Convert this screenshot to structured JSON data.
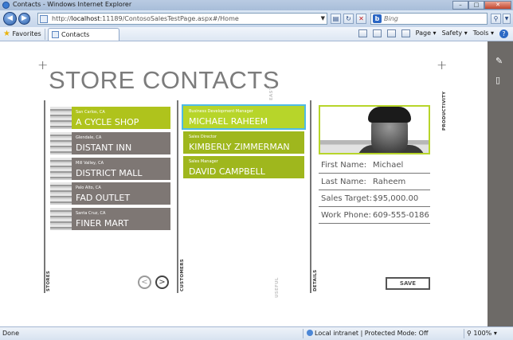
{
  "window": {
    "title": "Contacts - Windows Internet Explorer"
  },
  "address_bar": {
    "url_prefix": "http://",
    "url_host": "localhost",
    "url_rest": ":11189/ContosoSalesTestPage.aspx#/Home"
  },
  "search": {
    "placeholder": "Bing"
  },
  "favorites_bar": {
    "favorites_label": "Favorites",
    "tab_label": "Contacts",
    "menus": [
      "Page ▾",
      "Safety ▾",
      "Tools ▾"
    ]
  },
  "page": {
    "title": "STORE CONTACTS"
  },
  "section_labels": {
    "stores": "STORES",
    "customers": "CUSTOMERS",
    "details": "DETAILS",
    "easy": "EASY",
    "useful": "USEFUL",
    "productivity": "PRODUCTIVITY"
  },
  "stores": [
    {
      "city": "San Carlos, CA",
      "name": "A CYCLE SHOP",
      "selected": true
    },
    {
      "city": "Glendale, CA",
      "name": "DISTANT INN",
      "selected": false
    },
    {
      "city": "Mill Valley, CA",
      "name": "DISTRICT MALL",
      "selected": false
    },
    {
      "city": "Palo Alto, CA",
      "name": "FAD OUTLET",
      "selected": false
    },
    {
      "city": "Santa Cruz, CA",
      "name": "FINER MART",
      "selected": false
    }
  ],
  "pager": {
    "prev": "<",
    "next": ">"
  },
  "customers": [
    {
      "role": "Business Development Manager",
      "name": "MICHAEL RAHEEM",
      "selected": true
    },
    {
      "role": "Sales Director",
      "name": "KIMBERLY ZIMMERMAN",
      "selected": false
    },
    {
      "role": "Sales Manager",
      "name": "DAVID CAMPBELL",
      "selected": false
    }
  ],
  "details": [
    {
      "label": "First Name:",
      "value": "Michael"
    },
    {
      "label": "Last Name:",
      "value": "Raheem"
    },
    {
      "label": "Sales Target:",
      "value": "$95,000.00"
    },
    {
      "label": "Work Phone:",
      "value": "609-555-0186"
    }
  ],
  "save_label": "SAVE",
  "status": {
    "left": "Done",
    "zone": "Local intranet | Protected Mode: Off",
    "zoom": "100%"
  },
  "colors": {
    "store_tile": "#7e7774",
    "store_selected": "#afc31c",
    "customer_tile": "#9fb71d",
    "customer_selected_outline": "#4fbbe6",
    "side_panel": "#6d6a67"
  }
}
